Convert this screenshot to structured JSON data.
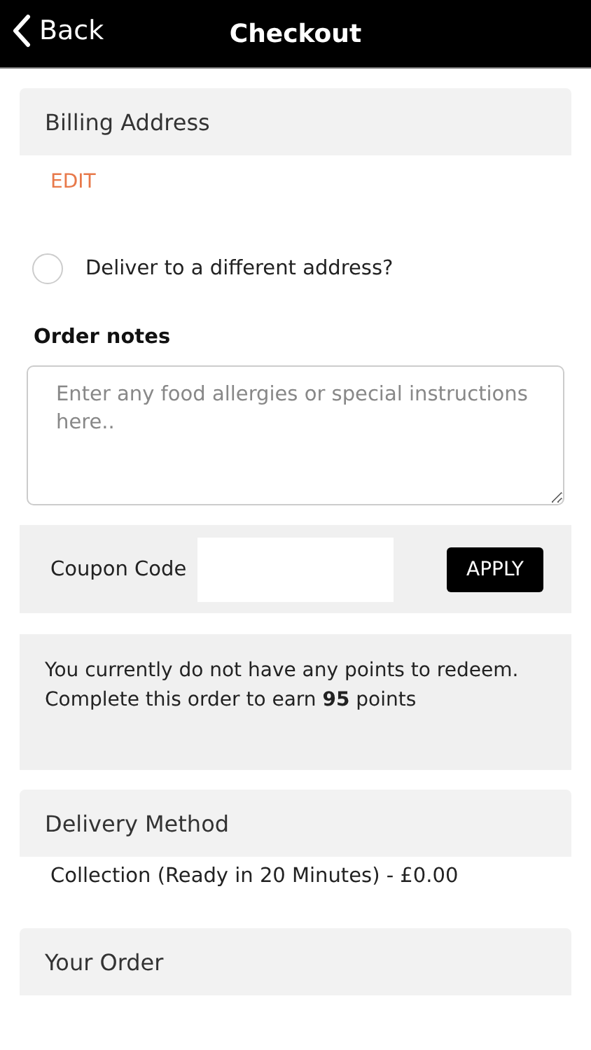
{
  "header": {
    "back": "Back",
    "title": "Checkout"
  },
  "billing": {
    "title": "Billing Address",
    "edit": "EDIT"
  },
  "different_address": {
    "label": "Deliver to a different address?",
    "checked": false
  },
  "order_notes": {
    "label": "Order notes",
    "placeholder": "Enter any food allergies or special instructions here.."
  },
  "coupon": {
    "label": "Coupon Code",
    "button": "APPLY"
  },
  "points": {
    "message": "You currently do not have any points to redeem. Complete this order to earn **95** points"
  },
  "delivery": {
    "title": "Delivery Method",
    "value": "Collection (Ready in 20 Minutes) - £0.00"
  },
  "your_order": {
    "title": "Your Order"
  }
}
